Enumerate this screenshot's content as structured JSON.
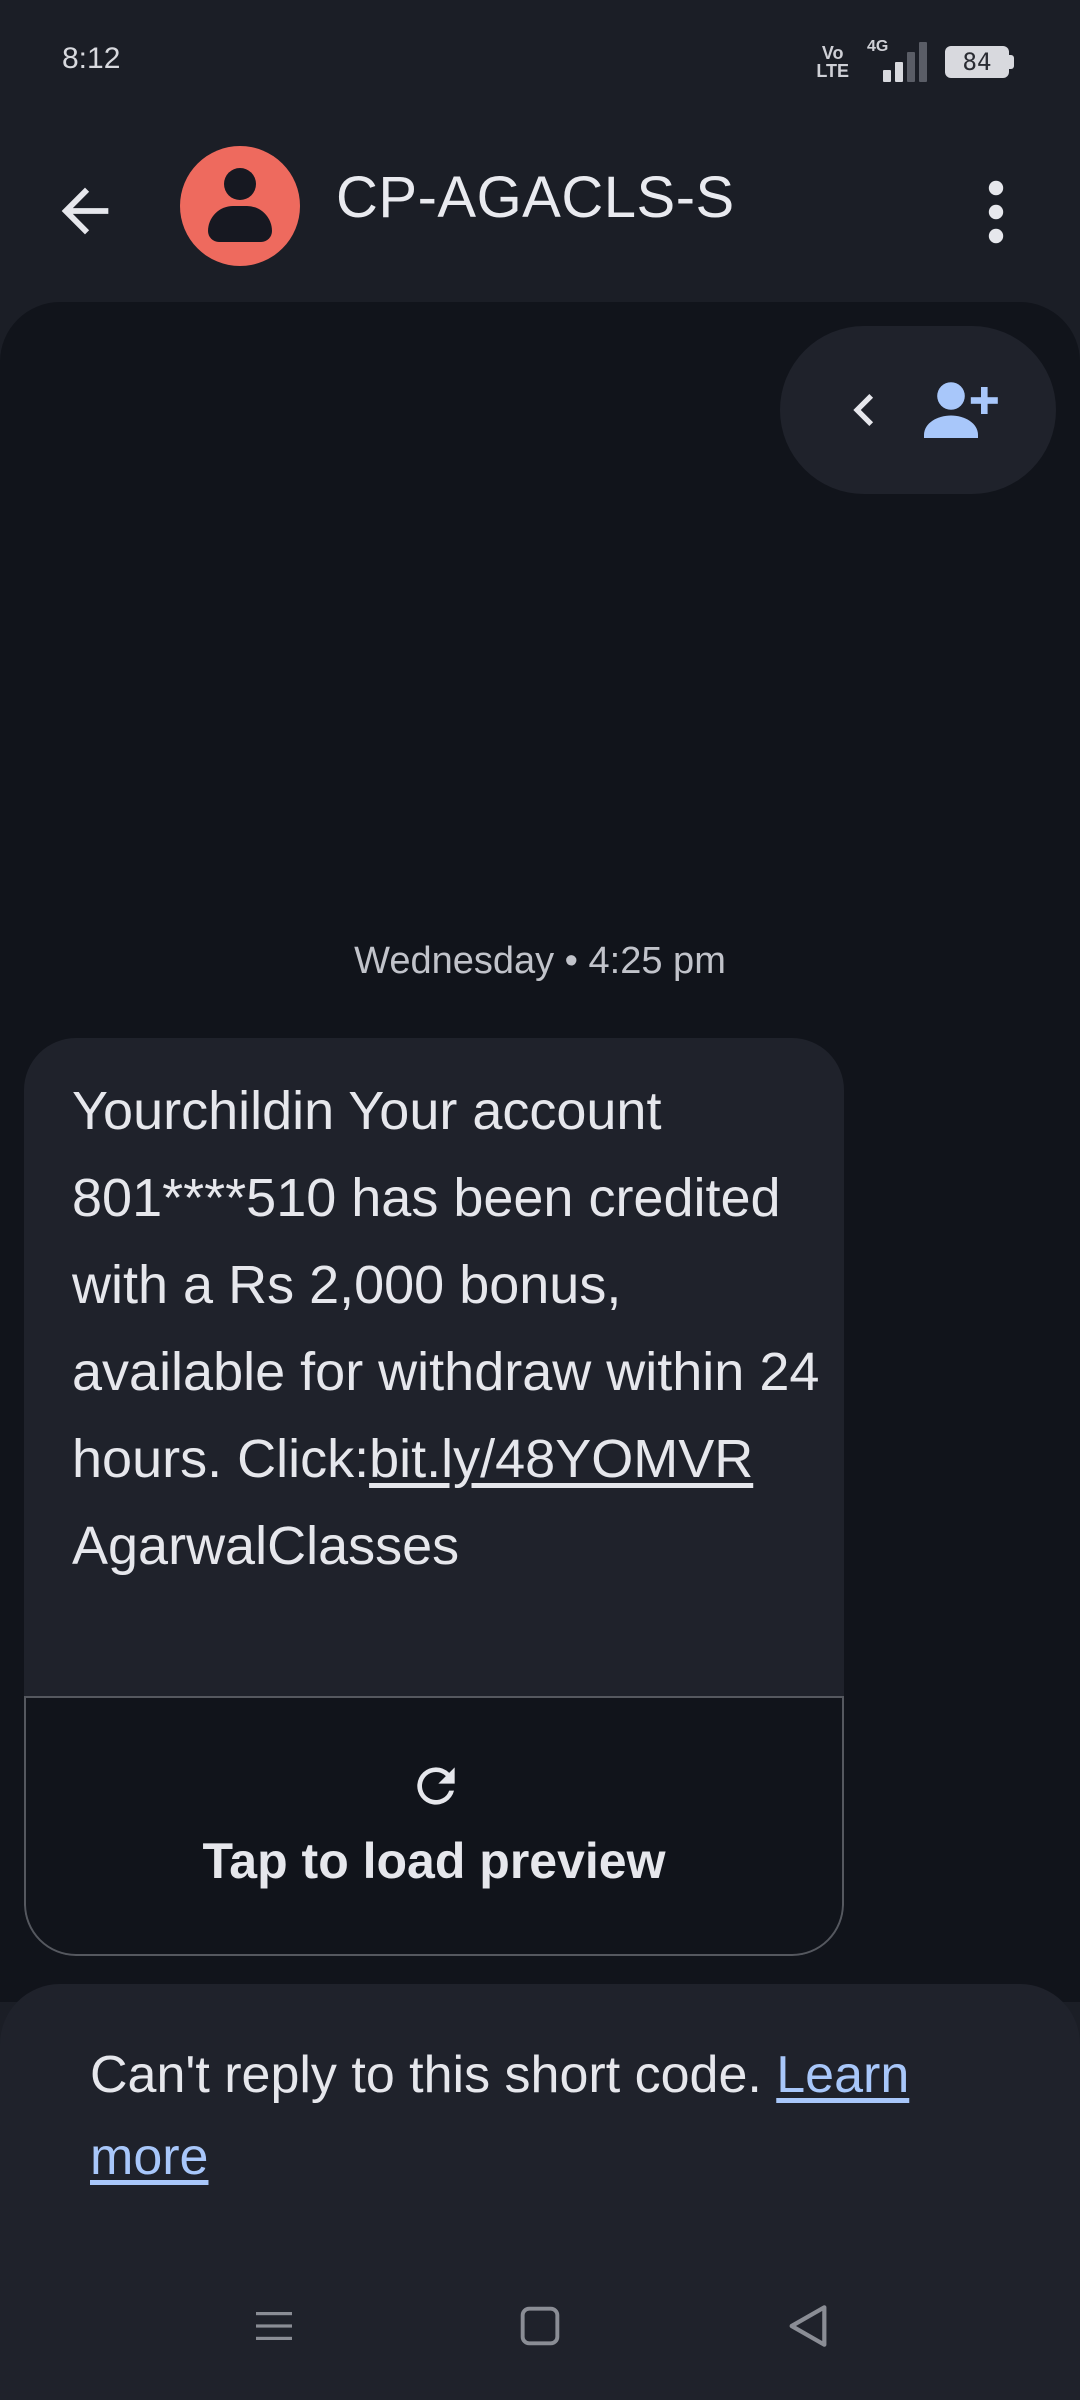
{
  "status_bar": {
    "time": "8:12",
    "volte_line1": "Vo",
    "volte_line2": "LTE",
    "network": "4G",
    "battery": "84"
  },
  "header": {
    "contact_name": "CP-AGACLS-S",
    "avatar_color": "#ee6a5e"
  },
  "conversation": {
    "timestamp": "Wednesday • 4:25 pm",
    "message": {
      "text_before_link": "Yourchildin Your account 801****510 has been credited with a Rs 2,000 bonus, available for withdraw within 24 hours. Click:",
      "link": "bit.ly/48YOMVR",
      "text_after_link": "AgarwalClasses"
    },
    "preview_label": "Tap to load preview"
  },
  "footer": {
    "notice": "Can't reply to this short code. ",
    "learn_more": "Learn more"
  },
  "colors": {
    "accent": "#a8c7fa",
    "background": "#1b1e26",
    "conversation_bg": "#11141b",
    "bubble_bg": "#1f222b"
  },
  "icons": {
    "back": "arrow-left-icon",
    "more": "more-vert-icon",
    "collapse": "chevron-left-icon",
    "add_contact": "person-add-icon",
    "reload": "refresh-icon"
  }
}
